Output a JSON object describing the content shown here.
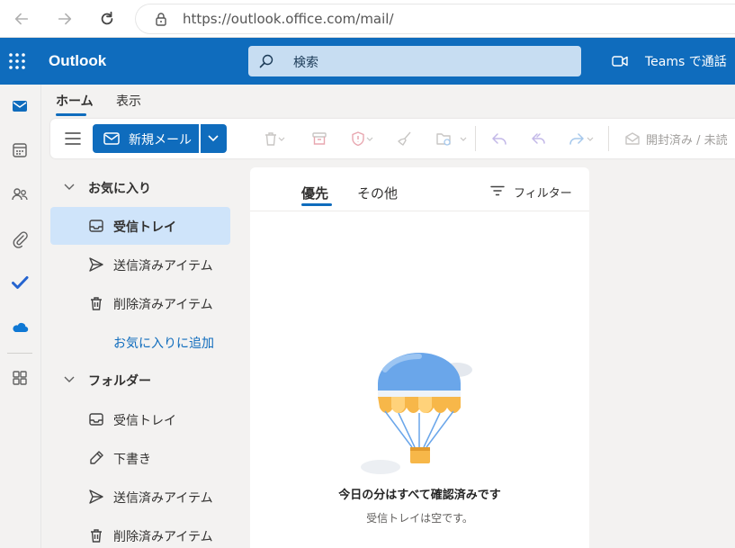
{
  "browser": {
    "url": "https://outlook.office.com/mail/"
  },
  "header": {
    "brand": "Outlook",
    "search_placeholder": "検索",
    "teams_label": "Teams で通話"
  },
  "ribbon": {
    "tabs": [
      {
        "label": "ホーム",
        "active": true
      },
      {
        "label": "表示",
        "active": false
      }
    ],
    "new_mail_label": "新規メール",
    "read_unread_label": "開封済み / 未読"
  },
  "folders": {
    "favorites_header": "お気に入り",
    "favorites": [
      {
        "label": "受信トレイ",
        "icon": "inbox-icon",
        "selected": true
      },
      {
        "label": "送信済みアイテム",
        "icon": "send-icon",
        "selected": false
      },
      {
        "label": "削除済みアイテム",
        "icon": "trash-icon",
        "selected": false
      }
    ],
    "add_favorite_link": "お気に入りに追加",
    "folders_header": "フォルダー",
    "folder_items": [
      {
        "label": "受信トレイ",
        "icon": "inbox-icon"
      },
      {
        "label": "下書き",
        "icon": "pencil-icon"
      },
      {
        "label": "送信済みアイテム",
        "icon": "send-icon"
      },
      {
        "label": "削除済みアイテム",
        "icon": "trash-icon"
      }
    ]
  },
  "message_list": {
    "tabs": [
      {
        "label": "優先",
        "active": true
      },
      {
        "label": "その他",
        "active": false
      }
    ],
    "filter_label": "フィルター",
    "empty_title": "今日の分はすべて確認済みです",
    "empty_subtitle": "受信トレイは空です。"
  },
  "colors": {
    "brand_blue": "#0f6cbd",
    "selected_item": "#cfe4fa",
    "search_bg": "#c7ddf2"
  }
}
